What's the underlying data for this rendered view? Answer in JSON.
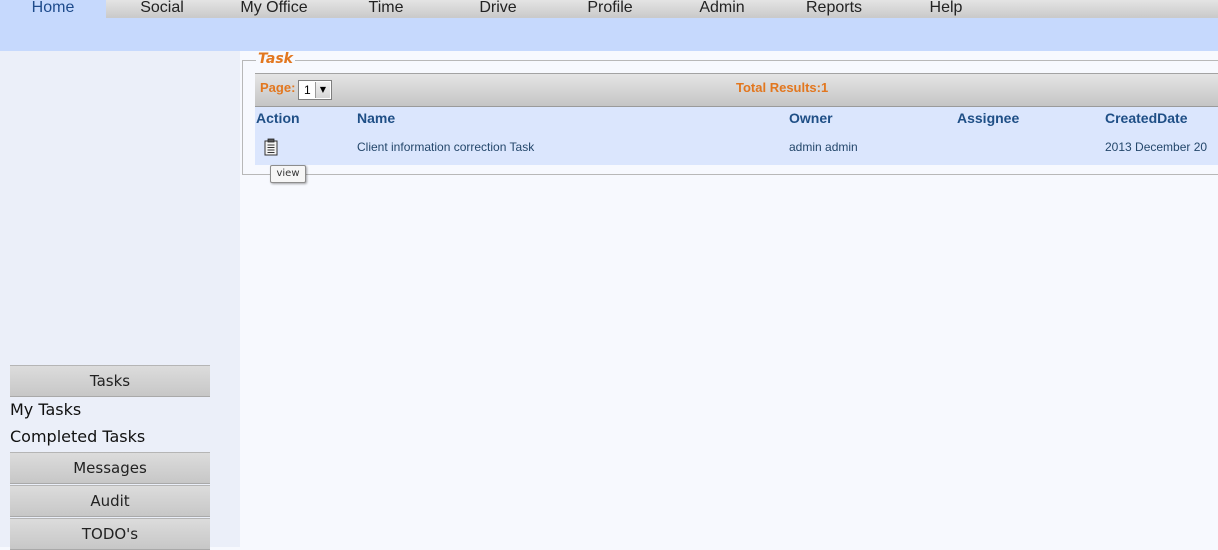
{
  "nav": {
    "items": [
      {
        "label": "Home",
        "active": true
      },
      {
        "label": "Social"
      },
      {
        "label": "My Office"
      },
      {
        "label": "Time"
      },
      {
        "label": "Drive"
      },
      {
        "label": "Profile"
      },
      {
        "label": "Admin"
      },
      {
        "label": "Reports"
      },
      {
        "label": "Help"
      }
    ]
  },
  "sidebar": {
    "tasks_button": "Tasks",
    "my_tasks": "My Tasks",
    "completed_tasks": "Completed Tasks",
    "messages_button": "Messages",
    "audit_button": "Audit",
    "todos_button": "TODO's"
  },
  "task_panel": {
    "legend": "Task",
    "page_label": "Page:",
    "page_value": "1",
    "total_results": "Total Results:1",
    "columns": {
      "action": "Action",
      "name": "Name",
      "owner": "Owner",
      "assignee": "Assignee",
      "created_date": "CreatedDate"
    },
    "rows": [
      {
        "action_icon": "clipboard-icon",
        "name": "Client information correction Task",
        "owner": "admin admin",
        "assignee": "",
        "created_date": "2013 December 20"
      }
    ],
    "tooltip": "view"
  },
  "colors": {
    "accent_orange": "#e2771f",
    "header_blue": "#1f4f86",
    "subbar_blue": "#c6d9fd"
  }
}
